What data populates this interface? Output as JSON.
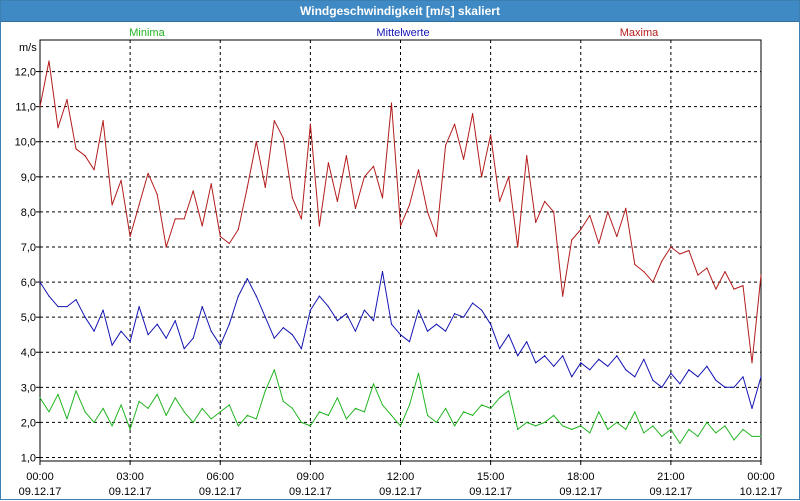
{
  "window": {
    "title": "Windgeschwindigkeit [m/s] skaliert"
  },
  "chart_data": {
    "type": "line",
    "title": "Windgeschwindigkeit [m/s] skaliert",
    "ylabel": "m/s",
    "xlabel": "",
    "ylim": [
      0.9,
      12.9
    ],
    "xlim": [
      0,
      24
    ],
    "grid": true,
    "legend_position": "top",
    "y_ticks": [
      "1,0",
      "2,0",
      "3,0",
      "4,0",
      "5,0",
      "6,0",
      "7,0",
      "8,0",
      "9,0",
      "10,0",
      "11,0",
      "12,0"
    ],
    "x_ticks": [
      {
        "time": "00:00",
        "date": "09.12.17"
      },
      {
        "time": "03:00",
        "date": "09.12.17"
      },
      {
        "time": "06:00",
        "date": "09.12.17"
      },
      {
        "time": "09:00",
        "date": "09.12.17"
      },
      {
        "time": "12:00",
        "date": "09.12.17"
      },
      {
        "time": "15:00",
        "date": "09.12.17"
      },
      {
        "time": "18:00",
        "date": "09.12.17"
      },
      {
        "time": "21:00",
        "date": "09.12.17"
      },
      {
        "time": "00:00",
        "date": "10.12.17"
      }
    ],
    "series": [
      {
        "name": "Minima",
        "color": "#22b422",
        "x": [
          0,
          0.3,
          0.6,
          0.9,
          1.2,
          1.5,
          1.8,
          2.1,
          2.4,
          2.7,
          3.0,
          3.3,
          3.6,
          3.9,
          4.2,
          4.5,
          4.8,
          5.1,
          5.4,
          5.7,
          6.0,
          6.3,
          6.6,
          6.9,
          7.2,
          7.5,
          7.8,
          8.1,
          8.4,
          8.7,
          9.0,
          9.3,
          9.6,
          9.9,
          10.2,
          10.5,
          10.8,
          11.1,
          11.4,
          11.7,
          12.0,
          12.3,
          12.6,
          12.9,
          13.2,
          13.5,
          13.8,
          14.1,
          14.4,
          14.7,
          15.0,
          15.3,
          15.6,
          15.9,
          16.2,
          16.5,
          16.8,
          17.1,
          17.4,
          17.7,
          18.0,
          18.3,
          18.6,
          18.9,
          19.2,
          19.5,
          19.8,
          20.1,
          20.4,
          20.7,
          21.0,
          21.3,
          21.6,
          21.9,
          22.2,
          22.5,
          22.8,
          23.1,
          23.4,
          23.7,
          24.0
        ],
        "values": [
          2.7,
          2.3,
          2.8,
          2.1,
          2.9,
          2.3,
          2.0,
          2.4,
          1.9,
          2.5,
          1.8,
          2.6,
          2.4,
          2.8,
          2.2,
          2.7,
          2.3,
          2.0,
          2.4,
          2.1,
          2.3,
          2.5,
          1.9,
          2.2,
          2.1,
          2.9,
          3.5,
          2.6,
          2.4,
          2.0,
          1.9,
          2.3,
          2.2,
          2.7,
          2.1,
          2.4,
          2.3,
          3.1,
          2.5,
          2.2,
          1.9,
          2.5,
          3.4,
          2.2,
          2.0,
          2.4,
          1.9,
          2.3,
          2.2,
          2.5,
          2.4,
          2.7,
          2.9,
          1.8,
          2.0,
          1.9,
          2.0,
          2.2,
          1.9,
          1.8,
          1.9,
          1.7,
          2.3,
          1.8,
          2.0,
          1.8,
          2.3,
          1.7,
          1.9,
          1.6,
          1.8,
          1.4,
          1.8,
          1.6,
          2.0,
          1.7,
          1.9,
          1.5,
          1.8,
          1.6,
          1.6
        ]
      },
      {
        "name": "Mittelwerte",
        "color": "#1515b4",
        "x": [
          0,
          0.3,
          0.6,
          0.9,
          1.2,
          1.5,
          1.8,
          2.1,
          2.4,
          2.7,
          3.0,
          3.3,
          3.6,
          3.9,
          4.2,
          4.5,
          4.8,
          5.1,
          5.4,
          5.7,
          6.0,
          6.3,
          6.6,
          6.9,
          7.2,
          7.5,
          7.8,
          8.1,
          8.4,
          8.7,
          9.0,
          9.3,
          9.6,
          9.9,
          10.2,
          10.5,
          10.8,
          11.1,
          11.4,
          11.7,
          12.0,
          12.3,
          12.6,
          12.9,
          13.2,
          13.5,
          13.8,
          14.1,
          14.4,
          14.7,
          15.0,
          15.3,
          15.6,
          15.9,
          16.2,
          16.5,
          16.8,
          17.1,
          17.4,
          17.7,
          18.0,
          18.3,
          18.6,
          18.9,
          19.2,
          19.5,
          19.8,
          20.1,
          20.4,
          20.7,
          21.0,
          21.3,
          21.6,
          21.9,
          22.2,
          22.5,
          22.8,
          23.1,
          23.4,
          23.7,
          24.0
        ],
        "values": [
          6.0,
          5.6,
          5.3,
          5.3,
          5.5,
          5.0,
          4.6,
          5.2,
          4.2,
          4.6,
          4.3,
          5.3,
          4.5,
          4.8,
          4.4,
          4.9,
          4.1,
          4.4,
          5.3,
          4.6,
          4.2,
          4.8,
          5.6,
          6.1,
          5.6,
          5.0,
          4.4,
          4.7,
          4.5,
          4.1,
          5.2,
          5.6,
          5.3,
          4.9,
          5.1,
          4.6,
          5.2,
          4.9,
          6.3,
          4.8,
          4.5,
          4.3,
          5.2,
          4.6,
          4.8,
          4.6,
          5.1,
          5.0,
          5.4,
          5.2,
          4.8,
          4.1,
          4.5,
          3.9,
          4.3,
          3.7,
          3.9,
          3.6,
          3.9,
          3.3,
          3.7,
          3.5,
          3.8,
          3.6,
          3.9,
          3.5,
          3.3,
          3.8,
          3.2,
          3.0,
          3.4,
          3.1,
          3.5,
          3.3,
          3.6,
          3.2,
          3.0,
          3.0,
          3.3,
          2.4,
          3.3
        ]
      },
      {
        "name": "Maxima",
        "color": "#b41c1c",
        "x": [
          0,
          0.3,
          0.6,
          0.9,
          1.2,
          1.5,
          1.8,
          2.1,
          2.4,
          2.7,
          3.0,
          3.3,
          3.6,
          3.9,
          4.2,
          4.5,
          4.8,
          5.1,
          5.4,
          5.7,
          6.0,
          6.3,
          6.6,
          6.9,
          7.2,
          7.5,
          7.8,
          8.1,
          8.4,
          8.7,
          9.0,
          9.3,
          9.6,
          9.9,
          10.2,
          10.5,
          10.8,
          11.1,
          11.4,
          11.7,
          12.0,
          12.3,
          12.6,
          12.9,
          13.2,
          13.5,
          13.8,
          14.1,
          14.4,
          14.7,
          15.0,
          15.3,
          15.6,
          15.9,
          16.2,
          16.5,
          16.8,
          17.1,
          17.4,
          17.7,
          18.0,
          18.3,
          18.6,
          18.9,
          19.2,
          19.5,
          19.8,
          20.1,
          20.4,
          20.7,
          21.0,
          21.3,
          21.6,
          21.9,
          22.2,
          22.5,
          22.8,
          23.1,
          23.4,
          23.7,
          24.0
        ],
        "values": [
          11.0,
          12.3,
          10.4,
          11.2,
          9.8,
          9.6,
          9.2,
          10.6,
          8.2,
          8.9,
          7.3,
          8.2,
          9.1,
          8.5,
          7.0,
          7.8,
          7.8,
          8.6,
          7.6,
          8.8,
          7.3,
          7.1,
          7.5,
          8.7,
          10.0,
          8.7,
          10.6,
          10.1,
          8.4,
          7.8,
          10.5,
          7.6,
          9.4,
          8.3,
          9.6,
          8.1,
          9.0,
          9.3,
          8.4,
          11.1,
          7.6,
          8.2,
          9.2,
          8.0,
          7.3,
          9.9,
          10.5,
          9.5,
          10.8,
          9.0,
          10.2,
          8.3,
          9.0,
          7.0,
          9.6,
          7.7,
          8.3,
          8.0,
          5.6,
          7.2,
          7.5,
          7.9,
          7.1,
          8.0,
          7.3,
          8.1,
          6.5,
          6.3,
          6.0,
          6.6,
          7.0,
          6.8,
          6.9,
          6.2,
          6.4,
          5.8,
          6.3,
          5.8,
          5.9,
          3.7,
          6.2
        ]
      }
    ]
  }
}
